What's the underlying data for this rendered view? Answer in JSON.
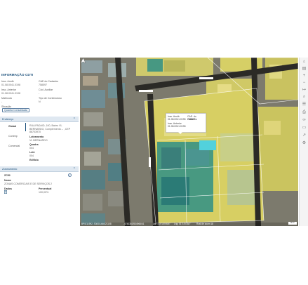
{
  "panel": {
    "title": "INFORMAÇÃO CDTI",
    "fields": {
      "insc_anulb_label": "Insc. Anulb",
      "insc_anulb_value": "01.08.0041.0198",
      "cad_cadastro_label": "CAE do Cadastro",
      "cad_cadastro_value": "758597",
      "insc_anterior_label": "Insc. Anterior",
      "insc_anterior_value": "01.08.0041.0198",
      "cod_auxiliar_label": "Cód. Auxiliar",
      "cod_auxiliar_value": "-",
      "matricula_label": "Matrícula",
      "matricula_value": "-",
      "tipo_contencioso_label": "Tipo de Contencioso",
      "tipo_contencioso_value": "N",
      "situacao_label": "Situação",
      "situacao_value": "Quadra Consolidada"
    }
  },
  "endereco": {
    "section_title": "Endereço",
    "global_label": "Global",
    "global_value": "RUA PADAID, 100, Bairro VL BERNARDO, Complemento – , CEP 86703970",
    "contrep_label": "Contrep",
    "logradouro_label": "Loteamento",
    "logradouro_value": "VL BERNARDO",
    "comercial_label": "Comercial",
    "quadra_label": "Quadra",
    "quadra_value": "004",
    "lote_label": "Lote",
    "lote_value": "004",
    "edificio_label": "Edifício"
  },
  "zoneamento": {
    "section_title": "Zoneamento",
    "code": "ZC52",
    "nome_label": "Nome",
    "nome_value": "ZONAS COMERCIAIS E DE SERVIÇOS 2",
    "dados_label": "Dados",
    "percentual_label": "Percentual",
    "percentual_value": "100,00%"
  },
  "popup": {
    "insc_anulb_label": "Insc. Anulb",
    "insc_anulb_value": "01.08.0041.0198",
    "cad_label": "CAE. do Cadastro",
    "cad_value": "758597",
    "insc_anterior_label": "Insc. Anterior",
    "insc_anterior_value": "01.08.0041.0198"
  },
  "map": {
    "street_labels": [
      "Rua Padaid",
      "Rua Aurea",
      "Av. Rio"
    ],
    "status": {
      "coord1": "BPS/11992, S300/1446/21108",
      "coord2": "-4743383/534966/41",
      "coord3": "Lat: -13°14'N'6/4\"",
      "coord4": "Lng: 01°15'0.84\"",
      "coord5": "Rcst de zoom 18"
    },
    "scale_text": "50 m"
  },
  "colors": {
    "accent": "#1a4f7a",
    "section_bg": "#dfe8f1",
    "zone_yellow": "#d9cf57",
    "zone_teal": "#2f8f86"
  },
  "toolbar_icons": [
    "home-icon",
    "layers-icon",
    "zoom-in-icon",
    "zoom-out-icon",
    "measure-icon",
    "search-icon",
    "list-icon",
    "print-icon",
    "link-icon",
    "chat-icon",
    "share-icon",
    "settings-icon"
  ]
}
